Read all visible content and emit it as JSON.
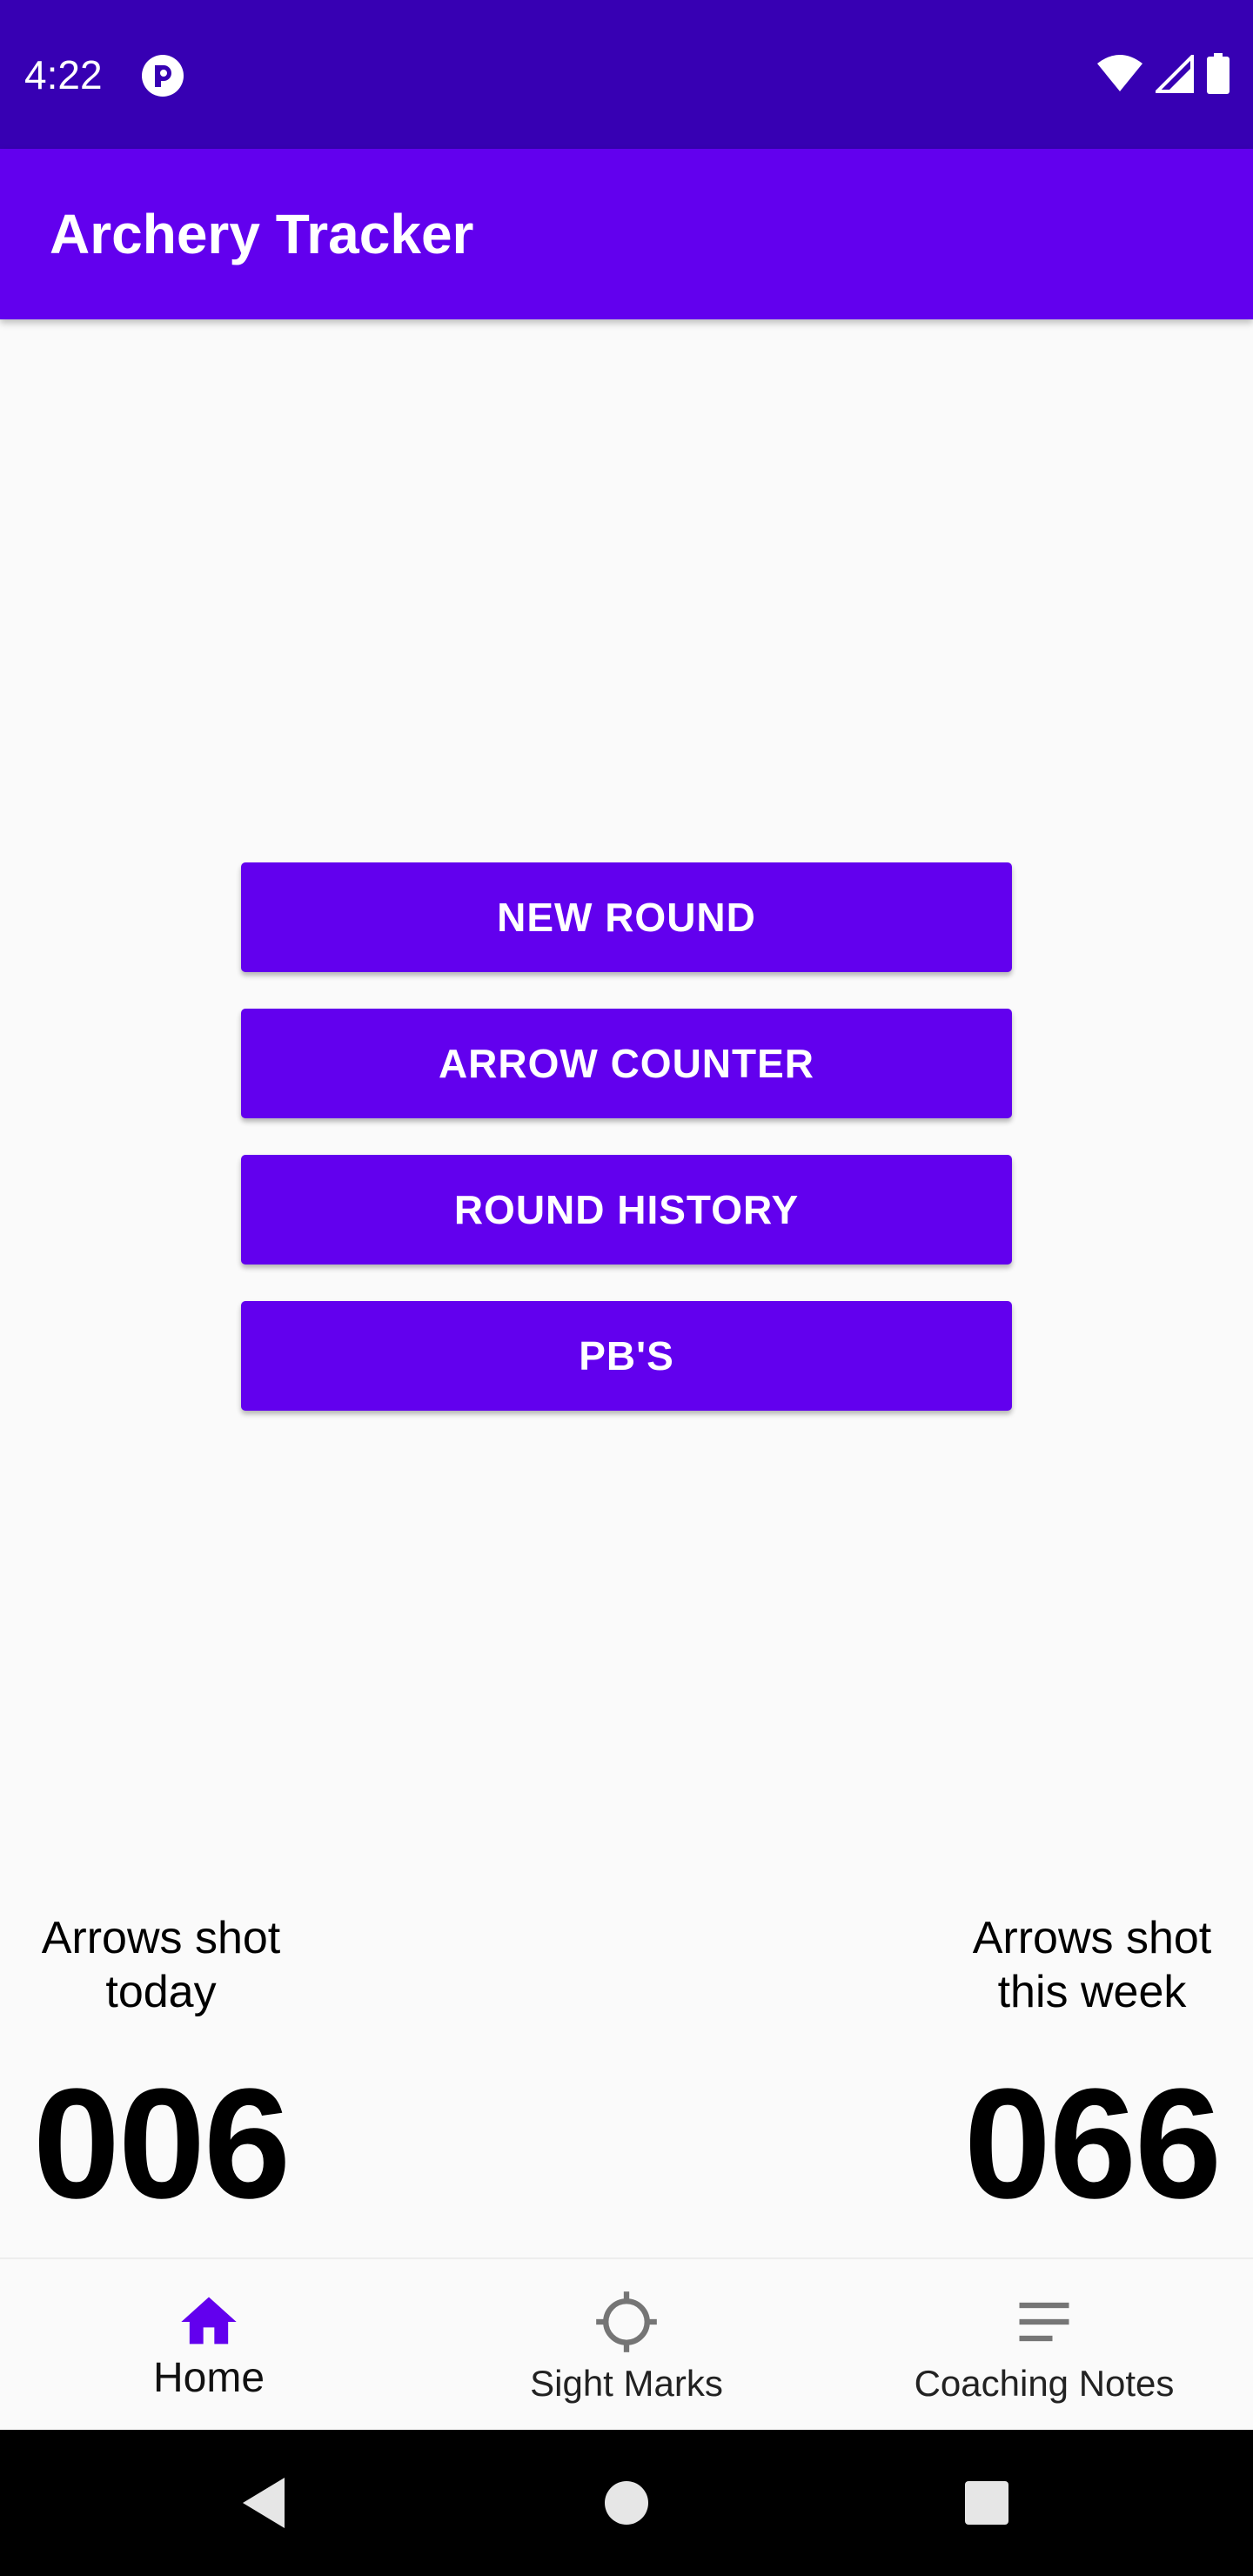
{
  "status_bar": {
    "time": "4:22",
    "icons": [
      "app-notification-icon",
      "wifi-icon",
      "signal-icon",
      "battery-icon"
    ]
  },
  "app_bar": {
    "title": "Archery Tracker"
  },
  "menu": {
    "buttons": [
      "NEW ROUND",
      "ARROW COUNTER",
      "ROUND HISTORY",
      "PB'S"
    ]
  },
  "stats": {
    "today": {
      "label": "Arrows shot\ntoday",
      "value": "006"
    },
    "week": {
      "label": "Arrows shot\nthis week",
      "value": "066"
    }
  },
  "bottom_nav": {
    "items": [
      {
        "label": "Home",
        "icon": "home-icon",
        "active": true
      },
      {
        "label": "Sight Marks",
        "icon": "crosshair-icon",
        "active": false
      },
      {
        "label": "Coaching Notes",
        "icon": "notes-icon",
        "active": false
      }
    ]
  },
  "system_nav": {
    "icons": [
      "back-icon",
      "home-circle-icon",
      "recents-icon"
    ]
  },
  "colors": {
    "status_bar": "#3700B3",
    "primary": "#6200EE",
    "background": "#FAFAFA",
    "button_text": "#FFFFFF",
    "inactive_icon": "#757575"
  }
}
